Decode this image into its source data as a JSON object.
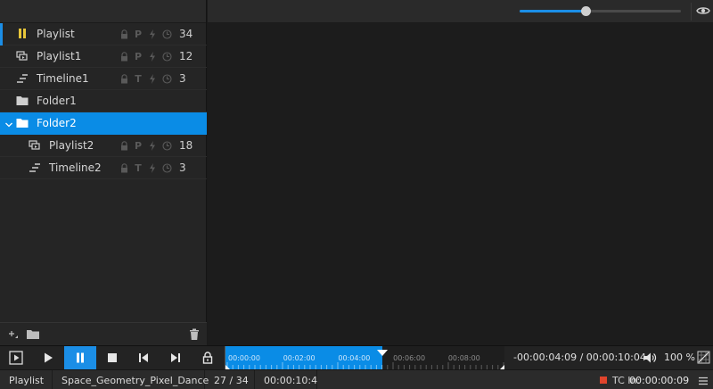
{
  "colors": {
    "accent": "#0a8ce6",
    "playlist_marker": "#e8c63a",
    "tc_red": "#e0442c"
  },
  "tree": [
    {
      "label": "Playlist",
      "icon": "pause-icon",
      "depth": 0,
      "flags": [
        "lock-icon",
        "P",
        "bolt-icon",
        "clock-icon"
      ],
      "count": "34",
      "active": true
    },
    {
      "label": "Playlist1",
      "icon": "playlist-icon",
      "depth": 0,
      "flags": [
        "lock-icon",
        "P",
        "bolt-icon",
        "clock-icon"
      ],
      "count": "12"
    },
    {
      "label": "Timeline1",
      "icon": "timeline-icon",
      "depth": 0,
      "flags": [
        "lock-icon",
        "T",
        "bolt-icon",
        "clock-icon"
      ],
      "count": "3"
    },
    {
      "label": "Folder1",
      "icon": "folder-icon",
      "depth": 0
    },
    {
      "label": "Folder2",
      "icon": "folder-icon",
      "depth": 0,
      "expanded": true,
      "selected": true
    },
    {
      "label": "Playlist2",
      "icon": "playlist-icon",
      "depth": 1,
      "flags": [
        "lock-icon",
        "P",
        "bolt-icon",
        "clock-icon"
      ],
      "count": "18"
    },
    {
      "label": "Timeline2",
      "icon": "timeline-icon",
      "depth": 1,
      "flags": [
        "lock-icon",
        "T",
        "bolt-icon",
        "clock-icon"
      ],
      "count": "3"
    }
  ],
  "zoom_level": 0.41,
  "transport": {
    "timeline_ticks": [
      "00:00:00",
      "00:02:00",
      "00:04:00",
      "00:06:00",
      "00:08:00"
    ],
    "progress": 0.56,
    "time_readout": "-00:00:04:09 / 00:00:10:04",
    "volume": "100 %"
  },
  "status": {
    "mode": "Playlist",
    "clip": "Space_Geometry_Pixel_Dance",
    "position": "27 / 34",
    "duration": "00:00:10:4",
    "tc_label": "TC In:",
    "tc_value": "00:00:00:09"
  }
}
